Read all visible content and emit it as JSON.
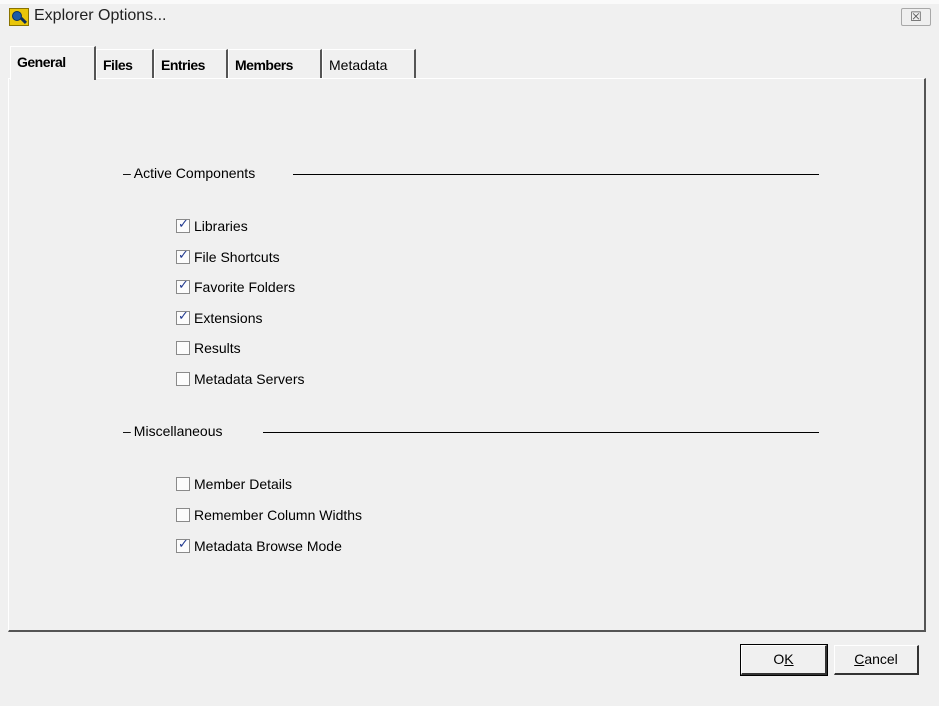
{
  "window": {
    "title": "Explorer Options...",
    "close_glyph": "☒",
    "app_icon": "explorer-app-icon"
  },
  "tabs": [
    {
      "label": "General",
      "active": true
    },
    {
      "label": "Files",
      "active": false
    },
    {
      "label": "Entries",
      "active": false
    },
    {
      "label": "Members",
      "active": false
    },
    {
      "label": "Metadata",
      "active": false
    }
  ],
  "groups": {
    "active_components": {
      "title": "Active Components",
      "items": [
        {
          "label": "Libraries",
          "checked": true
        },
        {
          "label": "File Shortcuts",
          "checked": true
        },
        {
          "label": "Favorite Folders",
          "checked": true
        },
        {
          "label": "Extensions",
          "checked": true
        },
        {
          "label": "Results",
          "checked": false
        },
        {
          "label": "Metadata Servers",
          "checked": false
        }
      ]
    },
    "miscellaneous": {
      "title": "Miscellaneous",
      "items": [
        {
          "label": "Member Details",
          "checked": false
        },
        {
          "label": "Remember Column Widths",
          "checked": false
        },
        {
          "label": "Metadata Browse Mode",
          "checked": true
        }
      ]
    }
  },
  "buttons": {
    "ok": "OK",
    "cancel": "Cancel"
  }
}
